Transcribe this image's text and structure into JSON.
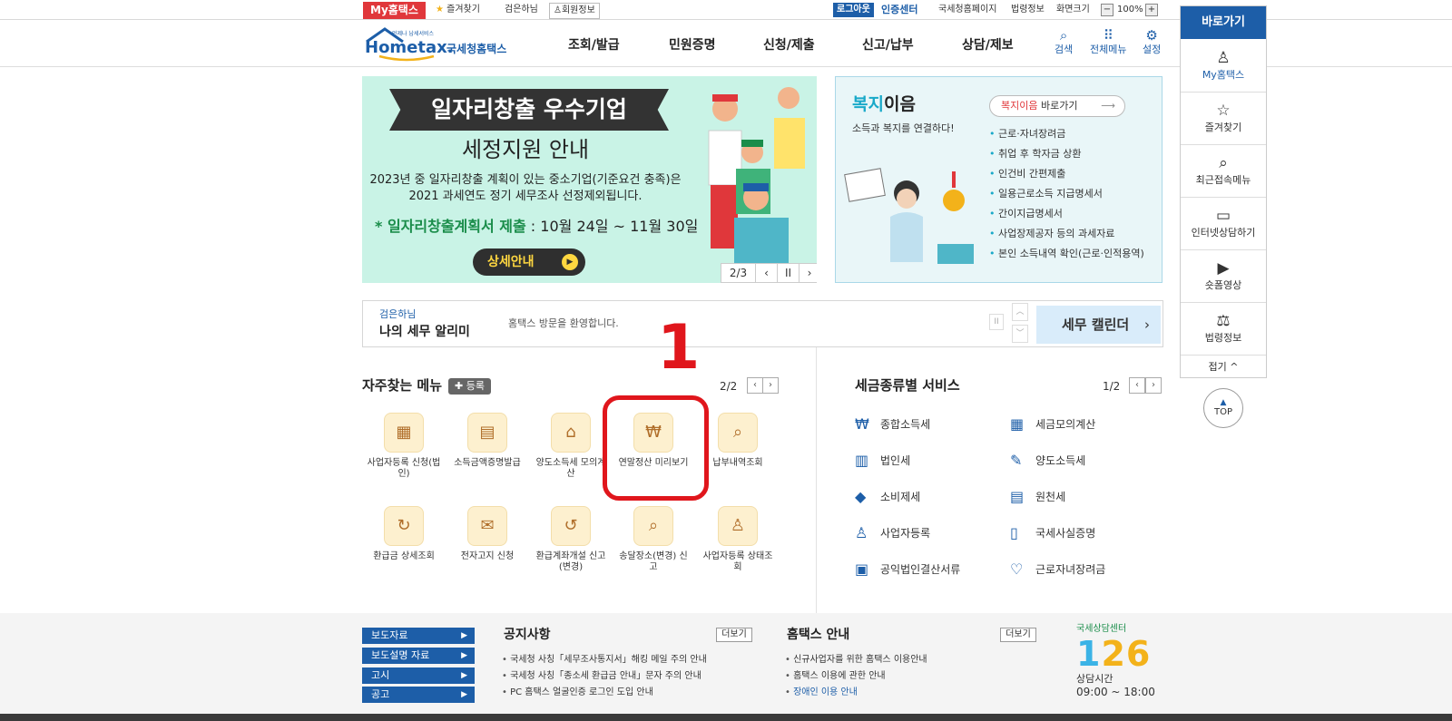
{
  "topbar": {
    "my_hometax": "My홈택스",
    "favorites": "즐겨찾기",
    "user_greeting": "검은하님",
    "member_info": "회원정보",
    "logout": "로그아웃",
    "cert_center": "인증센터",
    "nts_homepage": "국세청홈페이지",
    "law_info": "법령정보",
    "screen_size": "화면크기",
    "zoom_out": "−",
    "zoom_level": "100%",
    "zoom_in": "+"
  },
  "header": {
    "logo_tagline": "언제나 납세서비스",
    "logo_text": "Hometax.",
    "logo_sub": "국세청홈택스",
    "nav": [
      "조회/발급",
      "민원증명",
      "신청/제출",
      "신고/납부",
      "상담/제보"
    ],
    "icons": [
      {
        "label": "검색",
        "icon": "search-icon"
      },
      {
        "label": "전체메뉴",
        "icon": "grid-menu-icon"
      },
      {
        "label": "설정",
        "icon": "gear-icon"
      }
    ]
  },
  "banner": {
    "title": "일자리창출 우수기업",
    "subtitle": "세정지원 안내",
    "text1": "2023년 중 일자리창출 계획이 있는 중소기업(기준요건 충족)은",
    "text2": "2021 과세연도 정기 세무조사 선정제외됩니다.",
    "period_label": "* 일자리창출계획서 제출",
    "period_value": " : 10월 24일 ~ 11월 30일",
    "button": "상세안내",
    "page": "2/3",
    "prev": "‹",
    "pause": "II",
    "next": "›",
    "current_slide": 2,
    "total_slides": 3
  },
  "welfare": {
    "title_highlight": "복지",
    "title_rest": "이음",
    "subtitle": "소득과 복지를 연결하다!",
    "go_highlight": "복지이음",
    "go_rest": " 바로가기",
    "items": [
      "근로·자녀장려금",
      "취업 후 학자금 상환",
      "인건비 간편제출",
      "일용근로소득 지급명세서",
      "간이지급명세서",
      "사업장제공자 등의 과세자료",
      "본인 소득내역 확인(근로·인적용역)"
    ]
  },
  "alarm": {
    "user": "검은하님",
    "title": "나의 세무 알리미",
    "message": "홈택스 방문을 환영합니다.",
    "calendar": "세무 캘린더"
  },
  "frequent": {
    "title": "자주찾는 메뉴",
    "register": "✚ 등록",
    "page": "2/2",
    "annotation": "1",
    "items": [
      {
        "label": "사업자등록 신청(법인)",
        "icon": "calendar-icon"
      },
      {
        "label": "소득금액증명발급",
        "icon": "certificate-icon"
      },
      {
        "label": "양도소득세 모의계산",
        "icon": "house-icon"
      },
      {
        "label": "연말정산 미리보기",
        "icon": "money-bag-icon"
      },
      {
        "label": "납부내역조회",
        "icon": "receipt-search-icon"
      },
      {
        "label": "환급금 상세조회",
        "icon": "refund-icon"
      },
      {
        "label": "전자고지 신청",
        "icon": "e-notice-icon"
      },
      {
        "label": "환급계좌개설 신고(변경)",
        "icon": "refund-account-icon"
      },
      {
        "label": "송달장소(변경) 신고",
        "icon": "delivery-address-icon"
      },
      {
        "label": "사업자등록 상태조회",
        "icon": "business-status-icon"
      }
    ]
  },
  "tax_services": {
    "title": "세금종류별 서비스",
    "page": "1/2",
    "items": [
      {
        "label": "종합소득세",
        "icon": "income-tax-icon",
        "glyph": "₩"
      },
      {
        "label": "세금모의계산",
        "icon": "calculator-icon",
        "glyph": "▦"
      },
      {
        "label": "법인세",
        "icon": "building-icon",
        "glyph": "▥"
      },
      {
        "label": "양도소득세",
        "icon": "document-edit-icon",
        "glyph": "✎"
      },
      {
        "label": "소비제세",
        "icon": "diamond-icon",
        "glyph": "◆"
      },
      {
        "label": "원천세",
        "icon": "withholding-icon",
        "glyph": "▤"
      },
      {
        "label": "사업자등록",
        "icon": "person-icon",
        "glyph": "♙"
      },
      {
        "label": "국세사실증명",
        "icon": "document-icon",
        "glyph": "▯"
      },
      {
        "label": "공익법인결산서류",
        "icon": "clipboard-icon",
        "glyph": "▣"
      },
      {
        "label": "근로자녀장려금",
        "icon": "heart-icon",
        "glyph": "♡"
      }
    ]
  },
  "footer": {
    "buttons": [
      "보도자료",
      "보도설명 자료",
      "고시",
      "공고"
    ],
    "notice_title": "공지사항",
    "notice_more": "더보기",
    "notices": [
      "국세청 사칭「세무조사통지서」해킹 메일 주의 안내",
      "국세청 사칭「종소세 환급금 안내」문자 주의 안내",
      "PC 홈택스 얼굴인증 로그인 도입 안내"
    ],
    "guide_title": "홈택스 안내",
    "guide_more": "더보기",
    "guides": [
      "신규사업자를 위한 홈택스 이용안내",
      "홈택스 이용에 관한 안내",
      "장애인 이용 안내"
    ],
    "center_name": "국세상담센터",
    "center_number_a": "1",
    "center_number_b": "26",
    "center_number_c": "",
    "hours_label": "상담시간",
    "hours": "09:00 ~ 18:00"
  },
  "quick": {
    "title": "바로가기",
    "items": [
      {
        "label": "My홈택스",
        "icon": "user-icon",
        "glyph": "♙"
      },
      {
        "label": "즐겨찾기",
        "icon": "star-icon",
        "glyph": "☆"
      },
      {
        "label": "최근접속메뉴",
        "icon": "recent-menu-icon",
        "glyph": "⌕"
      },
      {
        "label": "인터넷상담하기",
        "icon": "laptop-icon",
        "glyph": "▭"
      },
      {
        "label": "숏폼영상",
        "icon": "video-icon",
        "glyph": "▶"
      },
      {
        "label": "법령정보",
        "icon": "gavel-icon",
        "glyph": "⚖"
      }
    ],
    "fold": "접기 ^",
    "top": "TOP"
  },
  "colors": {
    "brand_blue": "#1d5ea8",
    "red": "#e0373b",
    "banner_bg": "#c9f3e6",
    "welfare_bg": "#e9f6f8",
    "annotation_red": "#e0161c"
  }
}
